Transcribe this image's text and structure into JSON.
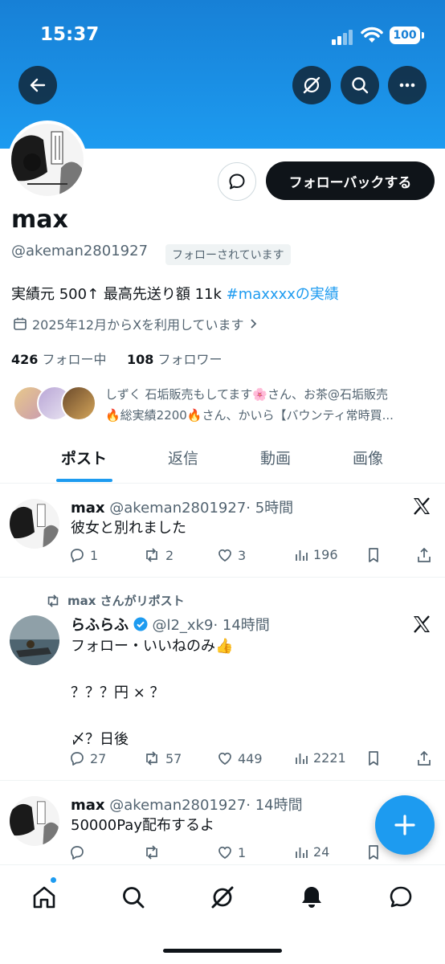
{
  "status": {
    "time": "15:37",
    "battery": "100"
  },
  "profile": {
    "name": "max",
    "handle": "@akeman2801927",
    "follows_you": "フォローされています",
    "follow_back_label": "フォローバックする",
    "bio_text": "実績元 500↑ 最高先送り額 11k ",
    "bio_hashtag": "#maxxxx",
    "bio_suffix": "の実績",
    "joined": "2025年12月からXを利用しています",
    "following_count": "426",
    "following_label": "フォロー中",
    "followers_count": "108",
    "followers_label": "フォロワー",
    "mutuals_line1": "しずく 石垢販売もしてます🌸さん、お茶@石垢販売",
    "mutuals_line2": "🔥総実績2200🔥さん、かいら【バウンティ常時買..."
  },
  "tabs": [
    "ポスト",
    "返信",
    "動画",
    "画像"
  ],
  "posts": [
    {
      "name": "max",
      "handle": "@akeman2801927",
      "time": "· 5時間",
      "text": "彼女と別れました",
      "replies": "1",
      "reposts": "2",
      "likes": "3",
      "views": "196"
    },
    {
      "repost_note": "max さんがリポスト",
      "name": "らふらふ",
      "handle": "@l2_xk9",
      "time": "· 14時間",
      "text": "フォロー・いいねのみ👍\n\n？？？円 × ？\n\n〆？日後",
      "replies": "27",
      "reposts": "57",
      "likes": "449",
      "views": "2221"
    },
    {
      "name": "max",
      "handle": "@akeman2801927",
      "time": "· 14時間",
      "text": "50000Pay配布するよ",
      "replies": "",
      "reposts": "",
      "likes": "1",
      "views": "24"
    }
  ],
  "colors": {
    "accent": "#1d9bf0",
    "dark": "#0f1419",
    "muted": "#536471"
  }
}
